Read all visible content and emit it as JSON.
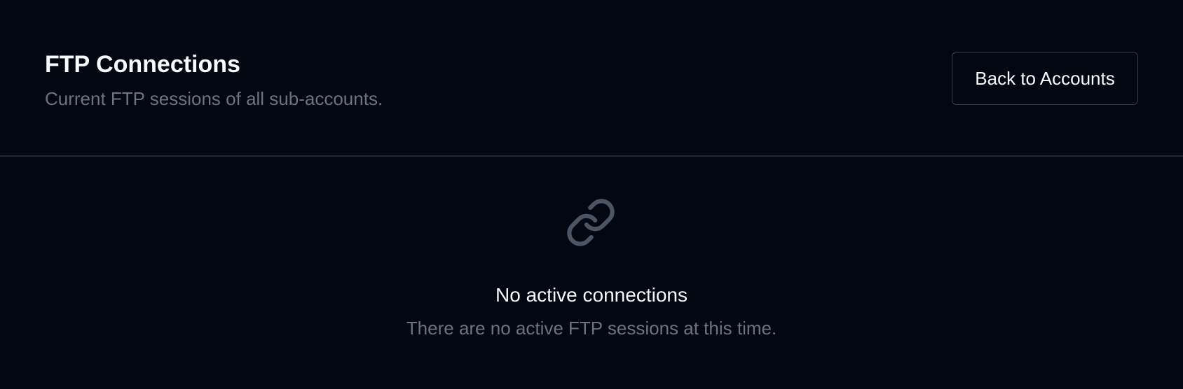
{
  "header": {
    "title": "FTP Connections",
    "subtitle": "Current FTP sessions of all sub-accounts.",
    "back_button_label": "Back to Accounts"
  },
  "empty_state": {
    "icon": "link-icon",
    "title": "No active connections",
    "description": "There are no active FTP sessions at this time."
  },
  "colors": {
    "background": "#030712",
    "divider": "#1f2937",
    "text_primary": "#f9fafb",
    "text_muted": "#6b7280",
    "icon": "#4b5563"
  }
}
